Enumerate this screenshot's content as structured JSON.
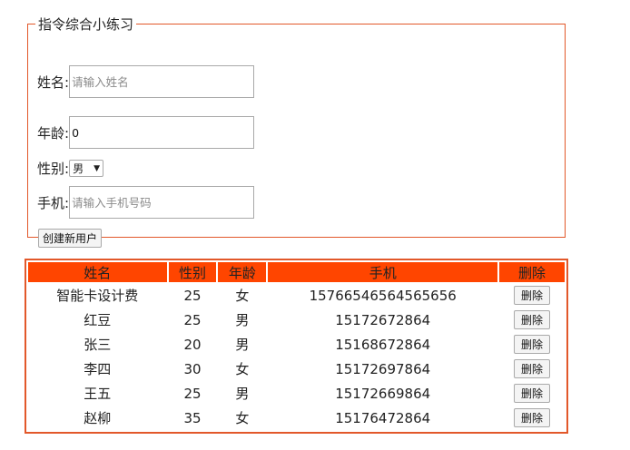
{
  "form": {
    "legend": "指令综合小练习",
    "name_label": "姓名:",
    "name_placeholder": "请输入姓名",
    "name_value": "",
    "age_label": "年龄:",
    "age_value": "0",
    "gender_label": "性别:",
    "gender_selected": "男",
    "phone_label": "手机:",
    "phone_placeholder": "请输入手机号码",
    "phone_value": "",
    "create_button": "创建新用户"
  },
  "table": {
    "headers": [
      "姓名",
      "性别",
      "年龄",
      "手机",
      "删除"
    ],
    "delete_label": "删除",
    "rows": [
      {
        "name": "智能卡设计费",
        "gender_col": "25",
        "age_col": "女",
        "phone": "15766546564565656"
      },
      {
        "name": "红豆",
        "gender_col": "25",
        "age_col": "男",
        "phone": "15172672864"
      },
      {
        "name": "张三",
        "gender_col": "20",
        "age_col": "男",
        "phone": "15168672864"
      },
      {
        "name": "李四",
        "gender_col": "30",
        "age_col": "女",
        "phone": "15172697864"
      },
      {
        "name": "王五",
        "gender_col": "25",
        "age_col": "男",
        "phone": "15172669864"
      },
      {
        "name": "赵柳",
        "gender_col": "35",
        "age_col": "女",
        "phone": "15176472864"
      }
    ]
  },
  "colors": {
    "accent_border": "#e2582a",
    "header_bg": "#ff4500"
  }
}
